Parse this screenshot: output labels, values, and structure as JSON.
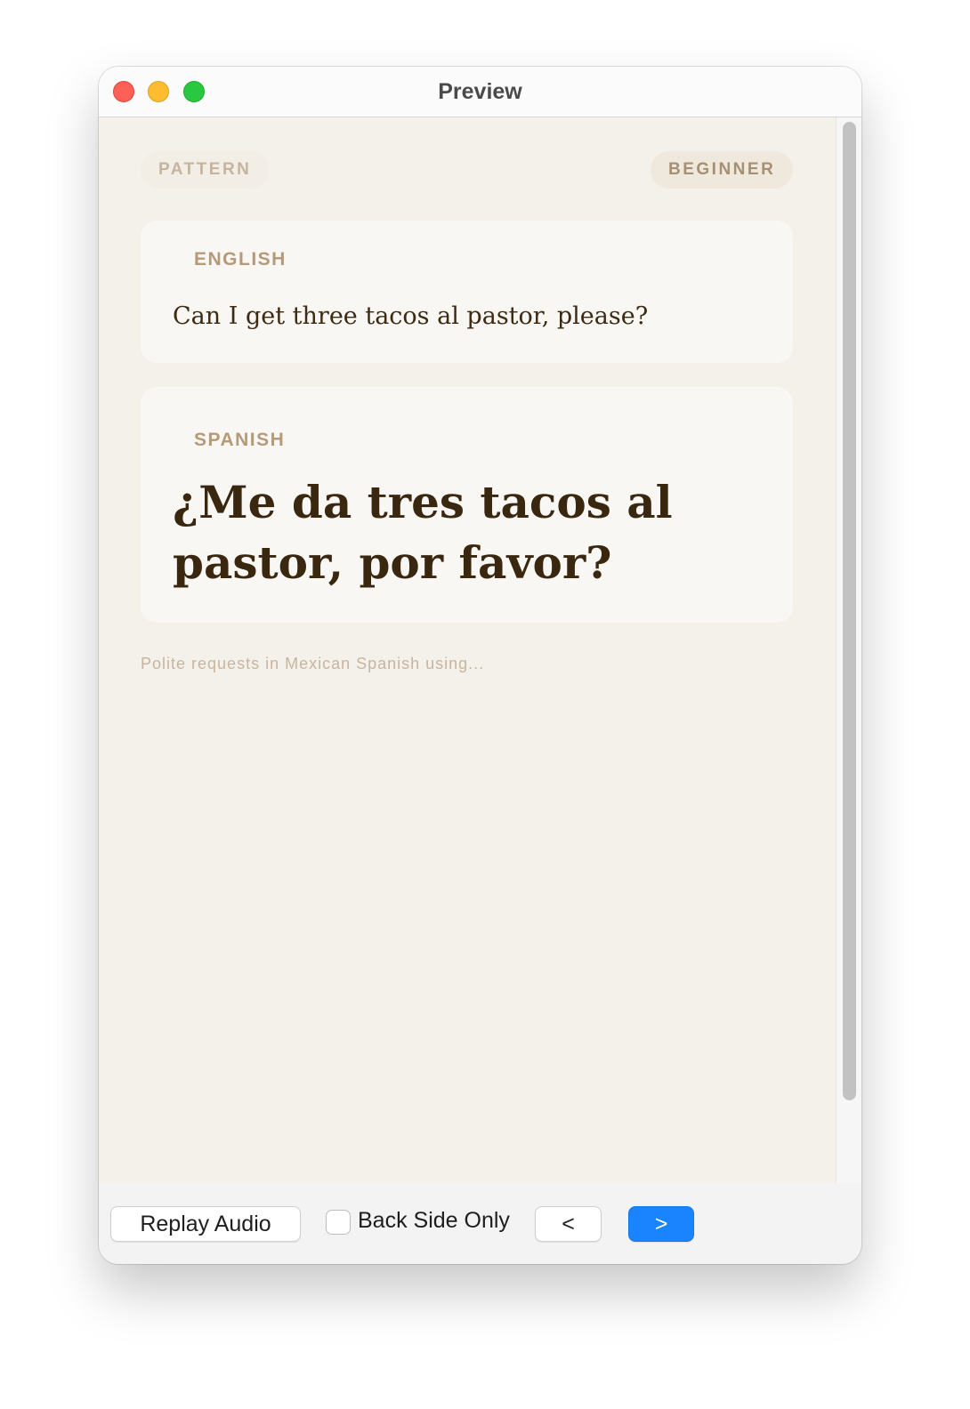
{
  "window": {
    "title": "Preview"
  },
  "card": {
    "type_badge": "PATTERN",
    "level_badge": "BEGINNER",
    "english_label": "ENGLISH",
    "english_text": "Can I get three tacos al pastor, please?",
    "spanish_label": "SPANISH",
    "spanish_text": "¿Me da tres tacos al pastor, por favor?",
    "note": "Polite requests in Mexican Spanish using..."
  },
  "footer": {
    "replay_label": "Replay Audio",
    "back_side_label": "Back Side Only",
    "back_side_checked": false,
    "prev_label": "<",
    "next_label": ">"
  },
  "colors": {
    "accent": "#1a84ff",
    "card_background": "#f4f0ea",
    "label_brown": "#b49a78",
    "text_dark": "#3a2710"
  }
}
